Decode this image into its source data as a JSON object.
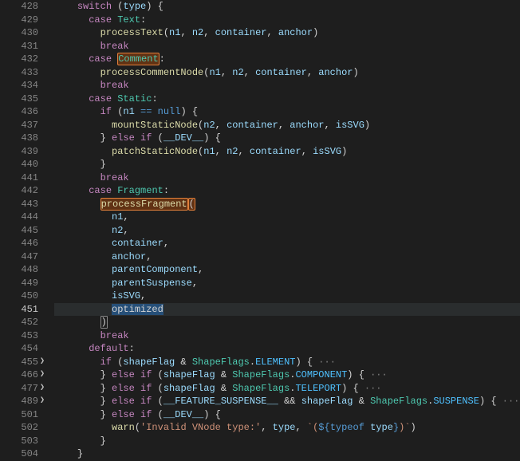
{
  "current_line": 451,
  "lines": [
    {
      "n": 428,
      "indent": 4,
      "tokens": [
        [
          "ctrl",
          "switch"
        ],
        [
          "pun",
          " ("
        ],
        [
          "var",
          "type"
        ],
        [
          "pun",
          ") {"
        ]
      ]
    },
    {
      "n": 429,
      "indent": 6,
      "tokens": [
        [
          "ctrl",
          "case"
        ],
        [
          "pun",
          " "
        ],
        [
          "type",
          "Text"
        ],
        [
          "pun",
          ":"
        ]
      ]
    },
    {
      "n": 430,
      "indent": 8,
      "tokens": [
        [
          "fn",
          "processText"
        ],
        [
          "pun",
          "("
        ],
        [
          "var",
          "n1"
        ],
        [
          "pun",
          ", "
        ],
        [
          "var",
          "n2"
        ],
        [
          "pun",
          ", "
        ],
        [
          "var",
          "container"
        ],
        [
          "pun",
          ", "
        ],
        [
          "var",
          "anchor"
        ],
        [
          "pun",
          ")"
        ]
      ]
    },
    {
      "n": 431,
      "indent": 8,
      "tokens": [
        [
          "ctrl",
          "break"
        ]
      ]
    },
    {
      "n": 432,
      "indent": 6,
      "tokens": [
        [
          "ctrl",
          "case"
        ],
        [
          "pun",
          " "
        ],
        [
          "type seltext",
          "Comment"
        ],
        [
          "pun",
          ":"
        ]
      ]
    },
    {
      "n": 433,
      "indent": 8,
      "tokens": [
        [
          "fn",
          "processCommentNode"
        ],
        [
          "pun",
          "("
        ],
        [
          "var",
          "n1"
        ],
        [
          "pun",
          ", "
        ],
        [
          "var",
          "n2"
        ],
        [
          "pun",
          ", "
        ],
        [
          "var",
          "container"
        ],
        [
          "pun",
          ", "
        ],
        [
          "var",
          "anchor"
        ],
        [
          "pun",
          ")"
        ]
      ]
    },
    {
      "n": 434,
      "indent": 8,
      "tokens": [
        [
          "ctrl",
          "break"
        ]
      ]
    },
    {
      "n": 435,
      "indent": 6,
      "tokens": [
        [
          "ctrl",
          "case"
        ],
        [
          "pun",
          " "
        ],
        [
          "type",
          "Static"
        ],
        [
          "pun",
          ":"
        ]
      ]
    },
    {
      "n": 436,
      "indent": 8,
      "tokens": [
        [
          "ctrl",
          "if"
        ],
        [
          "pun",
          " ("
        ],
        [
          "var",
          "n1"
        ],
        [
          "pun",
          " "
        ],
        [
          "kw",
          "=="
        ],
        [
          "pun",
          " "
        ],
        [
          "kw",
          "null"
        ],
        [
          "pun",
          ") {"
        ]
      ]
    },
    {
      "n": 437,
      "indent": 10,
      "tokens": [
        [
          "fn",
          "mountStaticNode"
        ],
        [
          "pun",
          "("
        ],
        [
          "var",
          "n2"
        ],
        [
          "pun",
          ", "
        ],
        [
          "var",
          "container"
        ],
        [
          "pun",
          ", "
        ],
        [
          "var",
          "anchor"
        ],
        [
          "pun",
          ", "
        ],
        [
          "var",
          "isSVG"
        ],
        [
          "pun",
          ")"
        ]
      ]
    },
    {
      "n": 438,
      "indent": 8,
      "tokens": [
        [
          "pun",
          "} "
        ],
        [
          "ctrl",
          "else"
        ],
        [
          "pun",
          " "
        ],
        [
          "ctrl",
          "if"
        ],
        [
          "pun",
          " ("
        ],
        [
          "var",
          "__DEV__"
        ],
        [
          "pun",
          ") {"
        ]
      ]
    },
    {
      "n": 439,
      "indent": 10,
      "tokens": [
        [
          "fn",
          "patchStaticNode"
        ],
        [
          "pun",
          "("
        ],
        [
          "var",
          "n1"
        ],
        [
          "pun",
          ", "
        ],
        [
          "var",
          "n2"
        ],
        [
          "pun",
          ", "
        ],
        [
          "var",
          "container"
        ],
        [
          "pun",
          ", "
        ],
        [
          "var",
          "isSVG"
        ],
        [
          "pun",
          ")"
        ]
      ]
    },
    {
      "n": 440,
      "indent": 8,
      "tokens": [
        [
          "pun",
          "}"
        ]
      ]
    },
    {
      "n": 441,
      "indent": 8,
      "tokens": [
        [
          "ctrl",
          "break"
        ]
      ]
    },
    {
      "n": 442,
      "indent": 6,
      "tokens": [
        [
          "ctrl",
          "case"
        ],
        [
          "pun",
          " "
        ],
        [
          "type",
          "Fragment"
        ],
        [
          "pun",
          ":"
        ]
      ]
    },
    {
      "n": 443,
      "indent": 8,
      "tokens": [
        [
          "fn seltext",
          "processFragment"
        ],
        [
          "pun seltext",
          "("
        ]
      ]
    },
    {
      "n": 444,
      "indent": 10,
      "tokens": [
        [
          "var",
          "n1"
        ],
        [
          "pun",
          ","
        ]
      ]
    },
    {
      "n": 445,
      "indent": 10,
      "tokens": [
        [
          "var",
          "n2"
        ],
        [
          "pun",
          ","
        ]
      ]
    },
    {
      "n": 446,
      "indent": 10,
      "tokens": [
        [
          "var",
          "container"
        ],
        [
          "pun",
          ","
        ]
      ]
    },
    {
      "n": 447,
      "indent": 10,
      "tokens": [
        [
          "var",
          "anchor"
        ],
        [
          "pun",
          ","
        ]
      ]
    },
    {
      "n": 448,
      "indent": 10,
      "tokens": [
        [
          "var",
          "parentComponent"
        ],
        [
          "pun",
          ","
        ]
      ]
    },
    {
      "n": 449,
      "indent": 10,
      "tokens": [
        [
          "var",
          "parentSuspense"
        ],
        [
          "pun",
          ","
        ]
      ]
    },
    {
      "n": 450,
      "indent": 10,
      "tokens": [
        [
          "var",
          "isSVG"
        ],
        [
          "pun",
          ","
        ]
      ]
    },
    {
      "n": 451,
      "hl": true,
      "indent": 10,
      "tokens": [
        [
          "var selcursor",
          "optimized"
        ]
      ]
    },
    {
      "n": 452,
      "indent": 8,
      "tokens": [
        [
          "pun bracketmatch",
          ")"
        ]
      ]
    },
    {
      "n": 453,
      "indent": 8,
      "tokens": [
        [
          "ctrl",
          "break"
        ]
      ]
    },
    {
      "n": 454,
      "indent": 6,
      "tokens": [
        [
          "ctrl",
          "default"
        ],
        [
          "pun",
          ":"
        ]
      ]
    },
    {
      "n": 455,
      "fold": true,
      "indent": 8,
      "tokens": [
        [
          "ctrl",
          "if"
        ],
        [
          "pun",
          " ("
        ],
        [
          "var",
          "shapeFlag"
        ],
        [
          "pun",
          " & "
        ],
        [
          "type",
          "ShapeFlags"
        ],
        [
          "pun",
          "."
        ],
        [
          "cnst",
          "ELEMENT"
        ],
        [
          "pun",
          ") {"
        ],
        [
          "folded",
          " ···"
        ]
      ]
    },
    {
      "n": 466,
      "fold": true,
      "indent": 8,
      "tokens": [
        [
          "pun",
          "} "
        ],
        [
          "ctrl",
          "else"
        ],
        [
          "pun",
          " "
        ],
        [
          "ctrl",
          "if"
        ],
        [
          "pun",
          " ("
        ],
        [
          "var",
          "shapeFlag"
        ],
        [
          "pun",
          " & "
        ],
        [
          "type",
          "ShapeFlags"
        ],
        [
          "pun",
          "."
        ],
        [
          "cnst",
          "COMPONENT"
        ],
        [
          "pun",
          ") {"
        ],
        [
          "folded",
          " ···"
        ]
      ]
    },
    {
      "n": 477,
      "fold": true,
      "indent": 8,
      "tokens": [
        [
          "pun",
          "} "
        ],
        [
          "ctrl",
          "else"
        ],
        [
          "pun",
          " "
        ],
        [
          "ctrl",
          "if"
        ],
        [
          "pun",
          " ("
        ],
        [
          "var",
          "shapeFlag"
        ],
        [
          "pun",
          " & "
        ],
        [
          "type",
          "ShapeFlags"
        ],
        [
          "pun",
          "."
        ],
        [
          "cnst",
          "TELEPORT"
        ],
        [
          "pun",
          ") {"
        ],
        [
          "folded",
          " ···"
        ]
      ]
    },
    {
      "n": 489,
      "fold": true,
      "indent": 8,
      "tokens": [
        [
          "pun",
          "} "
        ],
        [
          "ctrl",
          "else"
        ],
        [
          "pun",
          " "
        ],
        [
          "ctrl",
          "if"
        ],
        [
          "pun",
          " ("
        ],
        [
          "var",
          "__FEATURE_SUSPENSE__"
        ],
        [
          "pun",
          " && "
        ],
        [
          "var",
          "shapeFlag"
        ],
        [
          "pun",
          " & "
        ],
        [
          "type",
          "ShapeFlags"
        ],
        [
          "pun",
          "."
        ],
        [
          "cnst",
          "SUSPENSE"
        ],
        [
          "pun",
          ") {"
        ],
        [
          "folded",
          " ···"
        ]
      ]
    },
    {
      "n": 501,
      "indent": 8,
      "tokens": [
        [
          "pun",
          "} "
        ],
        [
          "ctrl",
          "else"
        ],
        [
          "pun",
          " "
        ],
        [
          "ctrl",
          "if"
        ],
        [
          "pun",
          " ("
        ],
        [
          "var",
          "__DEV__"
        ],
        [
          "pun",
          ") {"
        ]
      ]
    },
    {
      "n": 502,
      "indent": 10,
      "tokens": [
        [
          "fn",
          "warn"
        ],
        [
          "pun",
          "("
        ],
        [
          "str",
          "'Invalid VNode type:'"
        ],
        [
          "pun",
          ", "
        ],
        [
          "var",
          "type"
        ],
        [
          "pun",
          ", "
        ],
        [
          "str",
          "`("
        ],
        [
          "tmpl",
          "${"
        ],
        [
          "kw",
          "typeof"
        ],
        [
          "pun",
          " "
        ],
        [
          "var",
          "type"
        ],
        [
          "tmpl",
          "}"
        ],
        [
          "str",
          ")`"
        ],
        [
          "pun",
          ")"
        ]
      ]
    },
    {
      "n": 503,
      "indent": 8,
      "tokens": [
        [
          "pun",
          "}"
        ]
      ]
    },
    {
      "n": 504,
      "indent": 4,
      "tokens": [
        [
          "pun",
          "}"
        ]
      ]
    }
  ]
}
